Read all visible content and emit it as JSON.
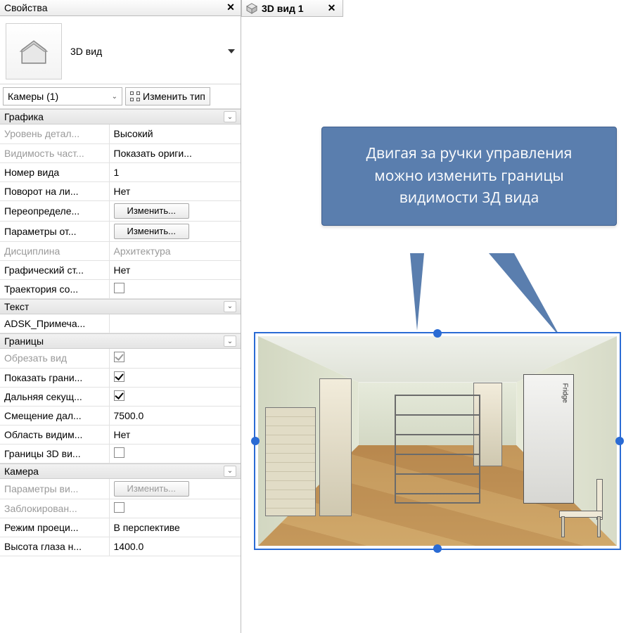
{
  "panel": {
    "title": "Свойства",
    "type_label": "3D вид",
    "instance_selector": "Камеры (1)",
    "edit_type": "Изменить тип"
  },
  "groups": [
    {
      "name": "Графика",
      "rows": [
        {
          "id": "detail",
          "label": "Уровень детал...",
          "value": "Высокий",
          "disabledLabel": true,
          "kind": "text"
        },
        {
          "id": "visparts",
          "label": "Видимость част...",
          "value": "Показать ориги...",
          "disabledLabel": true,
          "kind": "text"
        },
        {
          "id": "viewno",
          "label": "Номер вида",
          "value": "1",
          "kind": "text"
        },
        {
          "id": "rot",
          "label": "Поворот на ли...",
          "value": "Нет",
          "kind": "text"
        },
        {
          "id": "override",
          "label": "Переопределе...",
          "value": "Изменить...",
          "kind": "button"
        },
        {
          "id": "dispopt",
          "label": "Параметры от...",
          "value": "Изменить...",
          "kind": "button"
        },
        {
          "id": "disc",
          "label": "Дисциплина",
          "value": "Архитектура",
          "disabledLabel": true,
          "disabledValue": true,
          "kind": "text"
        },
        {
          "id": "gstyle",
          "label": "Графический ст...",
          "value": "Нет",
          "kind": "text"
        },
        {
          "id": "sunpath",
          "label": "Траектория со...",
          "value": "",
          "kind": "box"
        }
      ]
    },
    {
      "name": "Текст",
      "rows": [
        {
          "id": "adsk",
          "label": "ADSK_Примеча...",
          "value": "",
          "kind": "text"
        }
      ]
    },
    {
      "name": "Границы",
      "rows": [
        {
          "id": "crop",
          "label": "Обрезать вид",
          "value": "on",
          "disabledLabel": true,
          "disabledValue": true,
          "kind": "check"
        },
        {
          "id": "showcrop",
          "label": "Показать грани...",
          "value": "on",
          "kind": "check"
        },
        {
          "id": "farclip",
          "label": "Дальняя секущ...",
          "value": "on",
          "kind": "check"
        },
        {
          "id": "faroff",
          "label": "Смещение дал...",
          "value": "7500.0",
          "kind": "text"
        },
        {
          "id": "visreg",
          "label": "Область видим...",
          "value": "Нет",
          "kind": "text"
        },
        {
          "id": "bbox3d",
          "label": "Границы 3D ви...",
          "value": "",
          "kind": "box"
        }
      ]
    },
    {
      "name": "Камера",
      "rows": [
        {
          "id": "camparam",
          "label": "Параметры ви...",
          "value": "Изменить...",
          "disabledLabel": true,
          "disabledValue": true,
          "kind": "button"
        },
        {
          "id": "locked",
          "label": "Заблокирован...",
          "value": "off",
          "disabledLabel": true,
          "kind": "check"
        },
        {
          "id": "proj",
          "label": "Режим проеци...",
          "value": "В перспективе",
          "kind": "text"
        },
        {
          "id": "eye",
          "label": "Высота глаза н...",
          "value": "1400.0",
          "kind": "text"
        }
      ]
    }
  ],
  "view_tab": {
    "label": "3D вид 1"
  },
  "callout_text": "Двигая за ручки управления можно изменить границы видимости 3Д вида",
  "scene_labels": {
    "fridge": "Fridge"
  }
}
